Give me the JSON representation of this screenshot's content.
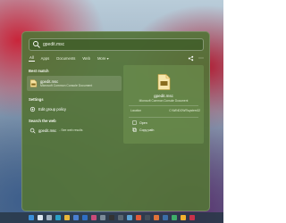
{
  "search": {
    "query": "gpedit.msc"
  },
  "tabs": [
    "All",
    "Apps",
    "Documents",
    "Web",
    "More"
  ],
  "sections": {
    "best_match": "Best match",
    "settings": "Settings",
    "search_web": "Search the web"
  },
  "best_match": {
    "title": "gpedit.msc",
    "subtitle": "Microsoft Common Console Document"
  },
  "settings_items": [
    {
      "label": "Edit group policy"
    }
  ],
  "web_items": [
    {
      "label": "gpedit.msc",
      "suffix": "- See web results"
    }
  ],
  "preview": {
    "title": "gpedit.msc",
    "subtitle": "Microsoft Common Console Document",
    "location_label": "Location",
    "location_value": "C:\\WINDOWS\\system32",
    "actions": [
      "Open",
      "Copy path"
    ]
  },
  "colors": {
    "panel": "#547338",
    "accent": "#cfa23a",
    "taskbar": "#283746"
  },
  "icons": [
    "search-icon",
    "chevron-down-icon",
    "share-icon",
    "more-icon",
    "file-icon",
    "settings-icon",
    "web-search-icon",
    "open-icon",
    "copy-icon"
  ],
  "taskbar_items": [
    "start-icon",
    "search-icon",
    "task-view-icon",
    "edge-icon",
    "file-explorer-icon",
    "store-icon",
    "mail-icon",
    "photos-icon",
    "settings-icon",
    "terminal-icon",
    "calculator-icon",
    "notepad-icon",
    "paint-icon",
    "camera-icon",
    "media-player-icon",
    "clock-icon",
    "maps-icon",
    "weather-icon",
    "news-icon"
  ]
}
